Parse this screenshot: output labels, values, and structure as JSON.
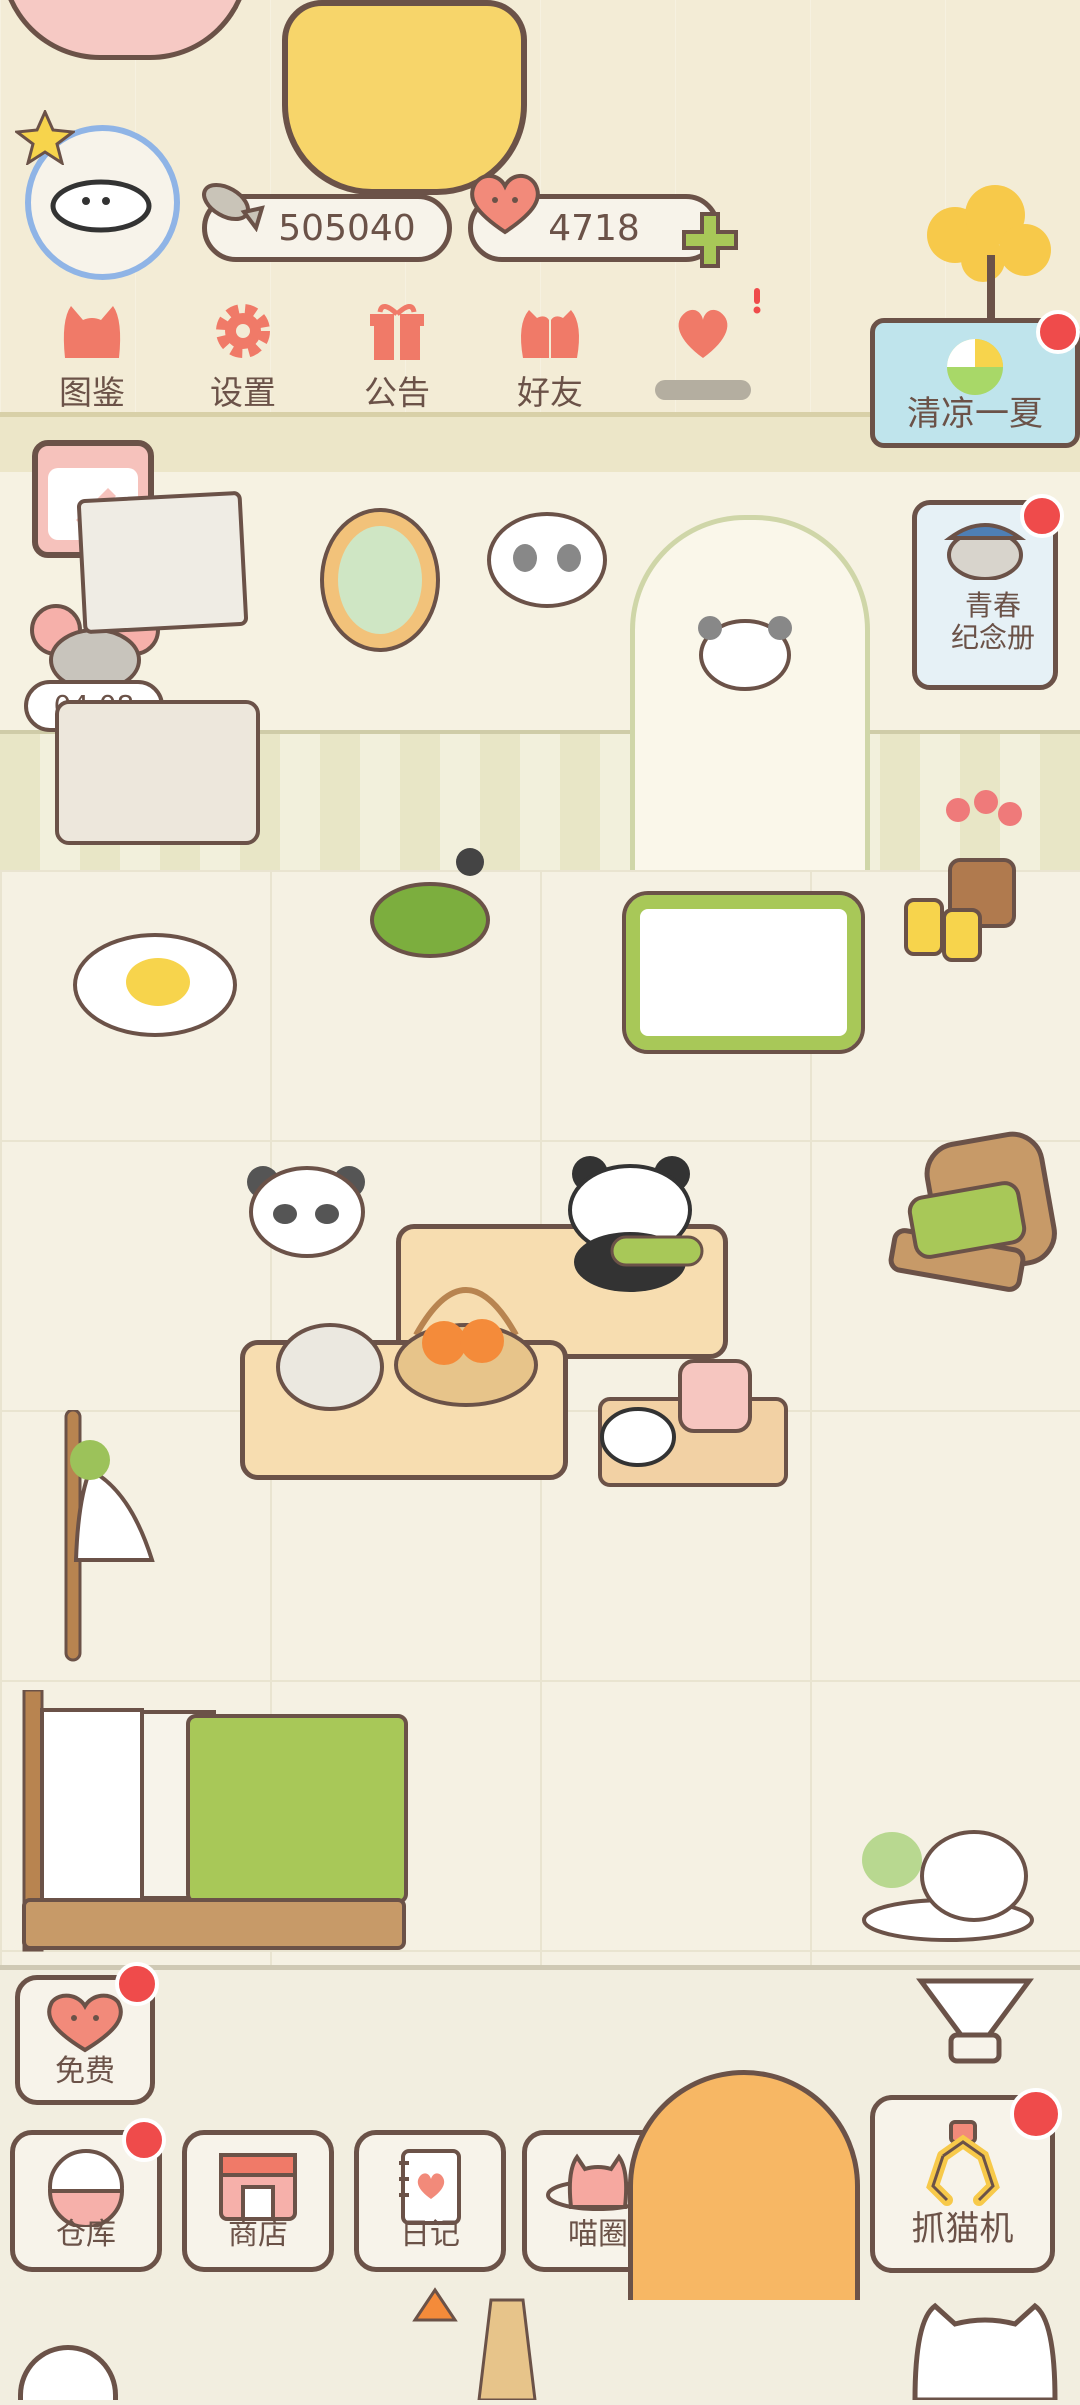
{
  "resources": {
    "fish_count": "505040",
    "heart_count": "4718"
  },
  "top_menu": [
    {
      "label": "图鉴",
      "icon": "cat-head-icon"
    },
    {
      "label": "设置",
      "icon": "gear-icon"
    },
    {
      "label": "公告",
      "icon": "gift-icon"
    },
    {
      "label": "好友",
      "icon": "friends-icon"
    },
    {
      "label": "",
      "icon": "heart-wing-icon"
    }
  ],
  "event": {
    "summer_label": "清凉一夏",
    "youth_label_line1": "青春",
    "youth_label_line2": "纪念册"
  },
  "timer": "04:08",
  "bottom": {
    "free_label": "免费",
    "claw_label": "抓猫机",
    "nav": [
      {
        "label": "仓库",
        "icon": "storage-icon"
      },
      {
        "label": "商店",
        "icon": "shop-icon"
      },
      {
        "label": "日记",
        "icon": "diary-icon"
      },
      {
        "label": "喵圈",
        "icon": "planet-cat-icon"
      }
    ]
  },
  "colors": {
    "outline": "#6b5248",
    "accent_red": "#ef4b4b",
    "menu_icon": "#f07a68",
    "plus_green": "#a8c858",
    "avatar_ring": "#8fb4e6"
  }
}
